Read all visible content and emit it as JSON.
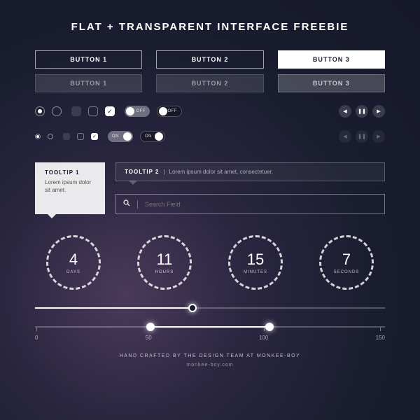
{
  "title": "FLAT + TRANSPARENT INTERFACE FREEBIE",
  "buttons": {
    "row1": [
      "BUTTON 1",
      "BUTTON 2",
      "BUTTON 3"
    ],
    "row2": [
      "BUTTON 1",
      "BUTTON 2",
      "BUTTON 3"
    ]
  },
  "toggles": {
    "off": "OFF",
    "on": "ON"
  },
  "tooltip1": {
    "title": "TOOLTIP 1",
    "body": "Lorem ipsum dolor sit amet."
  },
  "tooltip2": {
    "title": "TOOLTIP 2",
    "sep": "|",
    "body": "Lorem ipsum dolor sit amet, consectetuer."
  },
  "search": {
    "placeholder": "Search Field"
  },
  "countdown": [
    {
      "num": "4",
      "label": "DAYS"
    },
    {
      "num": "11",
      "label": "HOURS"
    },
    {
      "num": "15",
      "label": "MINUTES"
    },
    {
      "num": "7",
      "label": "SECONDS"
    }
  ],
  "slider1": {
    "value_pct": 45
  },
  "slider2": {
    "low_pct": 33,
    "high_pct": 67,
    "scale": [
      "0",
      "50",
      "100",
      "150"
    ]
  },
  "footer": {
    "line1": "HAND CRAFTED BY THE DESIGN TEAM AT MONKEE-BOY",
    "line2": "monkee-boy.com"
  }
}
